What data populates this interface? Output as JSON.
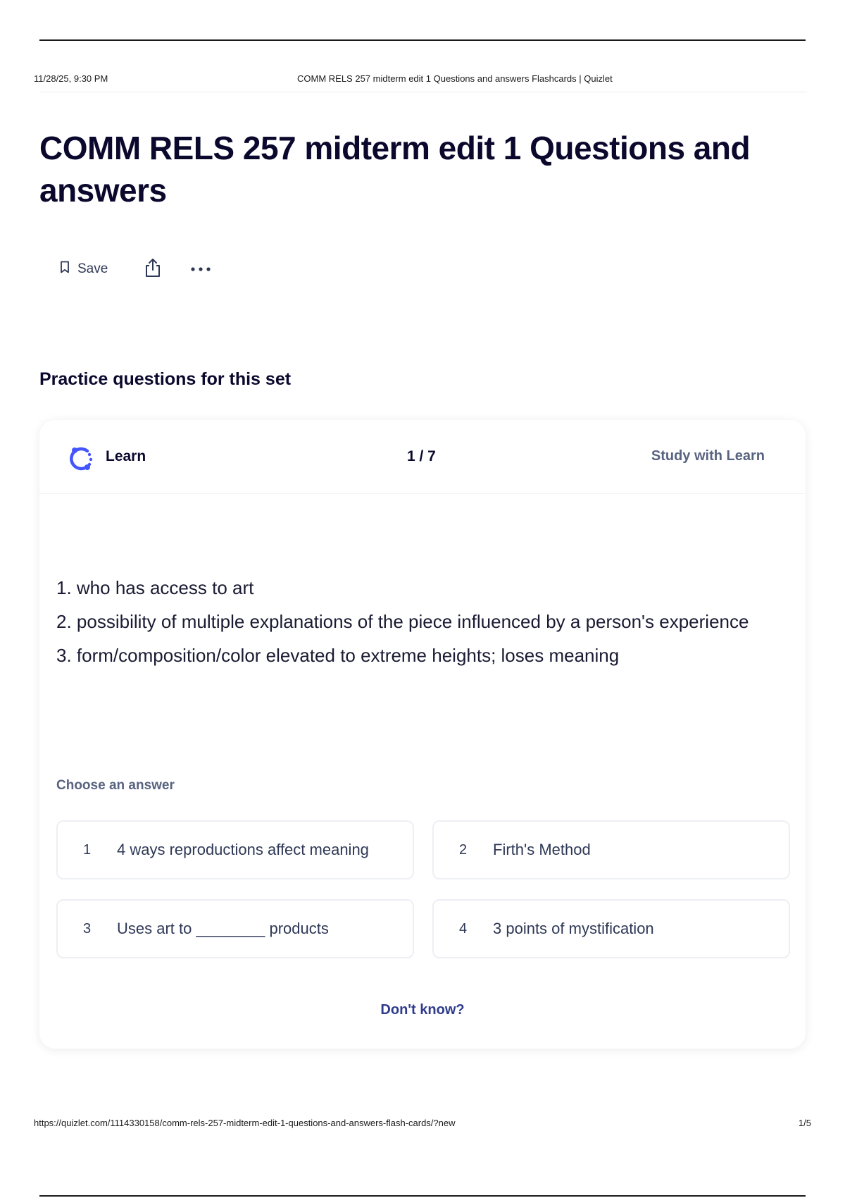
{
  "print_header": {
    "date": "11/28/25, 9:30 PM",
    "title": "COMM RELS 257 midterm edit 1 Questions and answers Flashcards | Quizlet"
  },
  "set": {
    "title": "COMM RELS 257 midterm edit 1 Questions and answers"
  },
  "actions": {
    "save_label": "Save",
    "icons": [
      "bookmark-icon",
      "share-icon",
      "more-options-icon"
    ]
  },
  "section_title": "Practice questions for this set",
  "learn": {
    "label": "Learn",
    "progress": "1 / 7",
    "study_link": "Study with Learn",
    "question_lines": [
      "1. who has access to art",
      "2. possibility of multiple explanations of the piece influenced by a person's experience",
      "3. form/composition/color elevated to extreme heights; loses meaning"
    ],
    "choose_label": "Choose an answer",
    "answers": [
      {
        "number": "1",
        "text": "4 ways reproductions affect meaning"
      },
      {
        "number": "2",
        "text": "Firth's Method"
      },
      {
        "number": "3",
        "text": "Uses art to ________ products"
      },
      {
        "number": "4",
        "text": "3 points of mystification"
      }
    ],
    "dont_know": "Don't know?",
    "accent_color": "#4255ff"
  },
  "print_footer": {
    "url": "https://quizlet.com/1114330158/comm-rels-257-midterm-edit-1-questions-and-answers-flash-cards/?new",
    "page": "1/5"
  }
}
